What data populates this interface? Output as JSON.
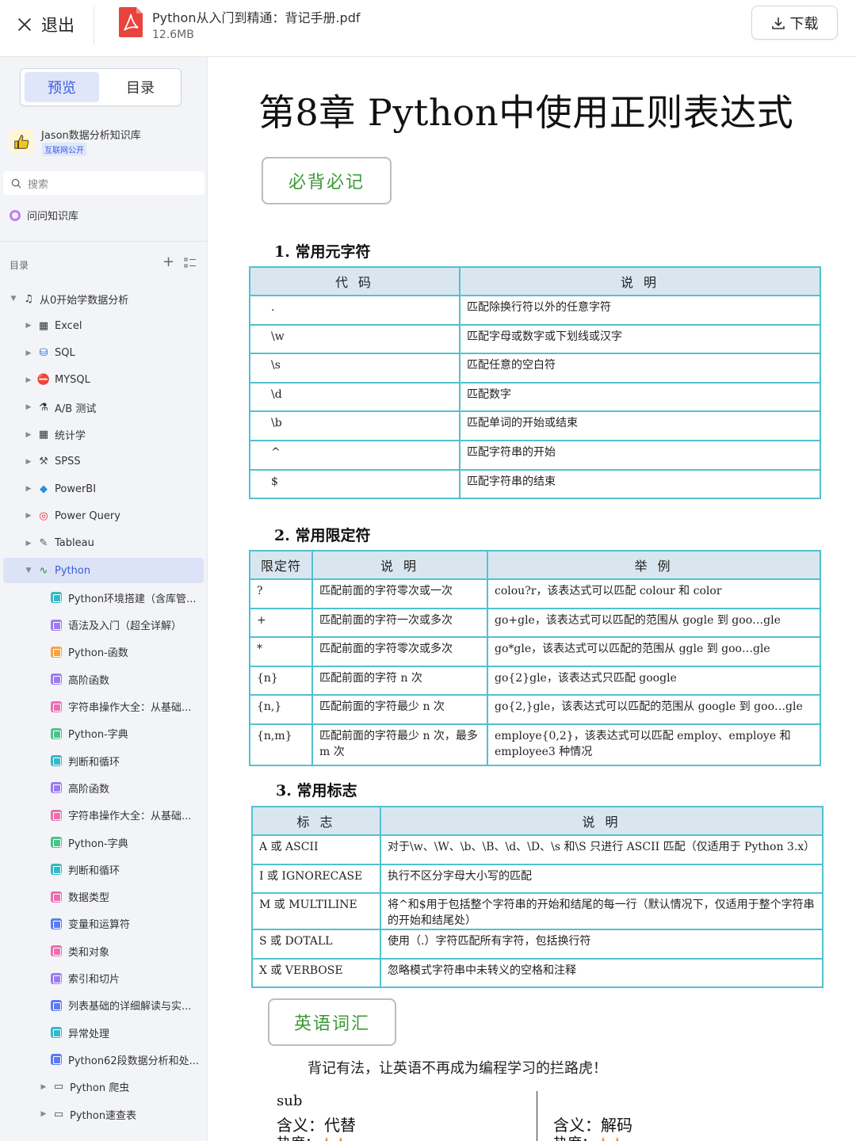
{
  "topbar": {
    "exit_label": "退出",
    "file_name": "Python从入门到精通：背记手册.pdf",
    "file_size": "12.6MB",
    "download_label": "下载"
  },
  "sidebar": {
    "tabs": [
      "预览",
      "目录"
    ],
    "kb_name": "Jason数据分析知识库",
    "kb_badge": "互联网公开",
    "search_placeholder": "搜索",
    "ask_label": "问问知识库",
    "toc_label": "目录",
    "tree": [
      {
        "label": "从0开始学数据分析",
        "level": 0,
        "icon": "music-note-icon",
        "expand": "open"
      },
      {
        "label": "Excel",
        "level": 1,
        "icon": "grid-icon",
        "expand": "closed"
      },
      {
        "label": "SQL",
        "level": 1,
        "icon": "database-icon",
        "expand": "closed"
      },
      {
        "label": "MYSQL",
        "level": 1,
        "icon": "no-entry-icon",
        "expand": "closed"
      },
      {
        "label": "A/B 测试",
        "level": 1,
        "icon": "flask-icon",
        "expand": "closed"
      },
      {
        "label": "统计学",
        "level": 1,
        "icon": "grid-icon",
        "expand": "closed"
      },
      {
        "label": "SPSS",
        "level": 1,
        "icon": "wand-icon",
        "expand": "closed"
      },
      {
        "label": "PowerBI",
        "level": 1,
        "icon": "gem-icon",
        "expand": "closed"
      },
      {
        "label": "Power Query",
        "level": 1,
        "icon": "target-icon",
        "expand": "closed"
      },
      {
        "label": "Tableau",
        "level": 1,
        "icon": "brush-icon",
        "expand": "closed"
      },
      {
        "label": "Python",
        "level": 1,
        "icon": "snake-icon",
        "expand": "open",
        "selected": true
      },
      {
        "label": "Python环境搭建（含库管...",
        "level": 2,
        "color": "#35b9c5"
      },
      {
        "label": "语法及入门（超全详解）",
        "level": 2,
        "color": "#9b7cf0"
      },
      {
        "label": "Python-函数",
        "level": 2,
        "color": "#f2a54a"
      },
      {
        "label": "高阶函数",
        "level": 2,
        "color": "#9b7cf0"
      },
      {
        "label": "字符串操作大全：从基础...",
        "level": 2,
        "color": "#e96fb0"
      },
      {
        "label": "Python-字典",
        "level": 2,
        "color": "#4cc38a"
      },
      {
        "label": "判断和循环",
        "level": 2,
        "color": "#35b9c5"
      },
      {
        "label": "高阶函数",
        "level": 2,
        "color": "#9b7cf0"
      },
      {
        "label": "字符串操作大全：从基础...",
        "level": 2,
        "color": "#e96fb0"
      },
      {
        "label": "Python-字典",
        "level": 2,
        "color": "#4cc38a"
      },
      {
        "label": "判断和循环",
        "level": 2,
        "color": "#35b9c5"
      },
      {
        "label": "数据类型",
        "level": 2,
        "color": "#e96fb0"
      },
      {
        "label": "变量和运算符",
        "level": 2,
        "color": "#5b7cf0"
      },
      {
        "label": "类和对象",
        "level": 2,
        "color": "#e96fb0"
      },
      {
        "label": "索引和切片",
        "level": 2,
        "color": "#9b7cf0"
      },
      {
        "label": "列表基础的详细解读与实...",
        "level": 2,
        "color": "#5b7cf0"
      },
      {
        "label": "异常处理",
        "level": 2,
        "color": "#35b9c5"
      },
      {
        "label": "Python62段数据分析和处...",
        "level": 2,
        "color": "#5b7cf0"
      },
      {
        "label": "Python 爬虫",
        "level": 2,
        "icon": "folder-icon",
        "expand": "closed"
      },
      {
        "label": "Python速查表",
        "level": 2,
        "icon": "folder-icon",
        "expand": "closed"
      }
    ]
  },
  "doc": {
    "chapter_title": "第8章 Python中使用正则表达式",
    "must_label": "必背必记",
    "section1": {
      "title": "1.  常用元字符",
      "headers": [
        "代 码",
        "说 明"
      ],
      "rows": [
        [
          ".",
          "匹配除换行符以外的任意字符"
        ],
        [
          "\\w",
          "匹配字母或数字或下划线或汉字"
        ],
        [
          "\\s",
          "匹配任意的空白符"
        ],
        [
          "\\d",
          "匹配数字"
        ],
        [
          "\\b",
          "匹配单词的开始或结束"
        ],
        [
          "^",
          "匹配字符串的开始"
        ],
        [
          "$",
          "匹配字符串的结束"
        ]
      ]
    },
    "section2": {
      "title": "2.  常用限定符",
      "headers": [
        "限定符",
        "说 明",
        "举 例"
      ],
      "rows": [
        [
          "?",
          "匹配前面的字符零次或一次",
          "colou?r，该表达式可以匹配 colour 和 color"
        ],
        [
          "+",
          "匹配前面的字符一次或多次",
          "go+gle，该表达式可以匹配的范围从 gogle 到 goo…gle"
        ],
        [
          "*",
          "匹配前面的字符零次或多次",
          "go*gle，该表达式可以匹配的范围从 ggle  到 goo…gle"
        ],
        [
          "{n}",
          "匹配前面的字符 n 次",
          "go{2}gle，该表达式只匹配 google"
        ],
        [
          "{n,}",
          "匹配前面的字符最少 n 次",
          "go{2,}gle，该表达式可以匹配的范围从 google 到 goo…gle"
        ],
        [
          "{n,m}",
          "匹配前面的字符最少 n 次，最多 m 次",
          "employe{0,2}，该表达式可以匹配 employ、employe 和 employee3 种情况"
        ]
      ]
    },
    "section3": {
      "title": "3.  常用标志",
      "headers": [
        "标 志",
        "说 明"
      ],
      "rows": [
        [
          "A 或 ASCII",
          "对于\\w、\\W、\\b、\\B、\\d、\\D、\\s  和\\S 只进行 ASCII 匹配（仅适用于 Python 3.x）"
        ],
        [
          "I 或 IGNORECASE",
          "执行不区分字母大小写的匹配"
        ],
        [
          "M 或 MULTILINE",
          "将^和$用于包括整个字符串的开始和结尾的每一行（默认情况下，仅适用于整个字符串的开始和结尾处）"
        ],
        [
          "S 或 DOTALL",
          "使用（.）字符匹配所有字符，包括换行符"
        ],
        [
          "X 或 VERBOSE",
          "忽略模式字符串中未转义的空格和注释"
        ]
      ]
    },
    "vocab_label": "英语词汇",
    "vocab_sub": "背记有法，让英语不再成为编程学习的拦路虎！",
    "vocab": [
      {
        "word": "sub",
        "meaning": "含义：代替",
        "freq": "热度"
      },
      {
        "meaning": "含义：解码",
        "freq": "热度"
      }
    ]
  }
}
